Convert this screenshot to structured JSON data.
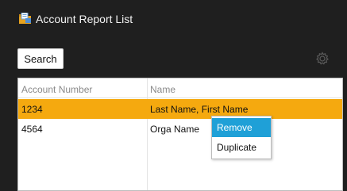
{
  "window": {
    "title": "Account Report List",
    "icon": "report-folder-icon"
  },
  "toolbar": {
    "search_label": "Search",
    "settings_icon": "gear-icon"
  },
  "table": {
    "columns": [
      "Account Number",
      "Name"
    ],
    "rows": [
      {
        "account_number": "1234",
        "name": "Last Name, First Name",
        "selected": true
      },
      {
        "account_number": "4564",
        "name": "Orga Name",
        "selected": false
      }
    ]
  },
  "context_menu": {
    "items": [
      {
        "label": "Remove",
        "highlighted": true
      },
      {
        "label": "Duplicate",
        "highlighted": false
      }
    ]
  },
  "colors": {
    "selected_row": "#f5a90f",
    "menu_highlight": "#1fa0d7",
    "window_background": "#1f1f1f"
  }
}
